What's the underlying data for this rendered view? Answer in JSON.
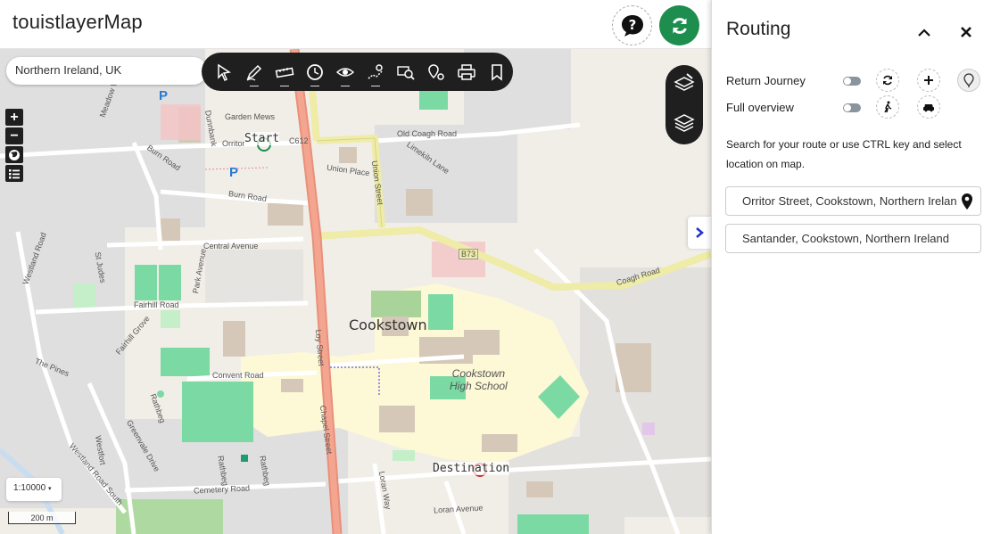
{
  "app": {
    "title": "touistlayerMap"
  },
  "header": {
    "help_icon": "question-bubble-icon",
    "refresh_icon": "refresh-icon",
    "accent": "#1e8e4e"
  },
  "map": {
    "search_value": "Northern Ireland, UK",
    "scale_value": "1:10000",
    "scale_bar_label": "200 m",
    "town_label": "Cookstown",
    "school_label_1": "Cookstown",
    "school_label_2": "High School",
    "start_label": "Start",
    "destination_label": "Destination",
    "roads": {
      "old_coagh": "Old Coagh Road",
      "coagh": "Coagh Road",
      "union_street": "Union Street",
      "union_place": "Union Place",
      "burn_road": "Burn Road",
      "burn_road_2": "Burn Road",
      "central_ave": "Central Avenue",
      "fairhill": "Fairhill Road",
      "convent": "Convent Road",
      "chapel": "Chapel Street",
      "loy": "Loy Street",
      "cemetery": "Cemetery Road",
      "westland": "Westland Road",
      "westland_south": "Westland Road South",
      "loran": "Loran Way",
      "loran_ave": "Loran Avenue",
      "garden_mews": "Garden Mews",
      "orritor": "Orritor",
      "c612": "C612",
      "b73": "B73",
      "limekiln": "Limekiln Lane",
      "park_ave": "Park Avenue",
      "fairhill_grove": "Fairhill Grove",
      "the_pines": "The Pines",
      "rathbeg": "Rathbeg",
      "rathbeg_2": "Rathbeg",
      "rathbeg_3": "Rathbeg",
      "greenvale": "Greenvale Drive",
      "westfort": "Westfort",
      "meadow_view": "Meadow View",
      "st_judes": "St Judes",
      "dunnbank": "Dunnbank"
    }
  },
  "toolbar": {
    "tools": [
      "cursor-icon",
      "draw-icon",
      "measure-icon",
      "time-icon",
      "eye-icon",
      "route-map-icon",
      "search-map-icon",
      "poi-icon",
      "print-icon",
      "bookmark-icon"
    ]
  },
  "zoom": {
    "in": "+",
    "out": "−"
  },
  "routing": {
    "title": "Routing",
    "return_journey": "Return Journey",
    "full_overview": "Full overview",
    "hint": "Search for your route or use CTRL key and select location on map.",
    "from_value": "Orritor Street, Cookstown, Northern Ireland",
    "to_value": "Santander, Cookstown, Northern Ireland"
  }
}
